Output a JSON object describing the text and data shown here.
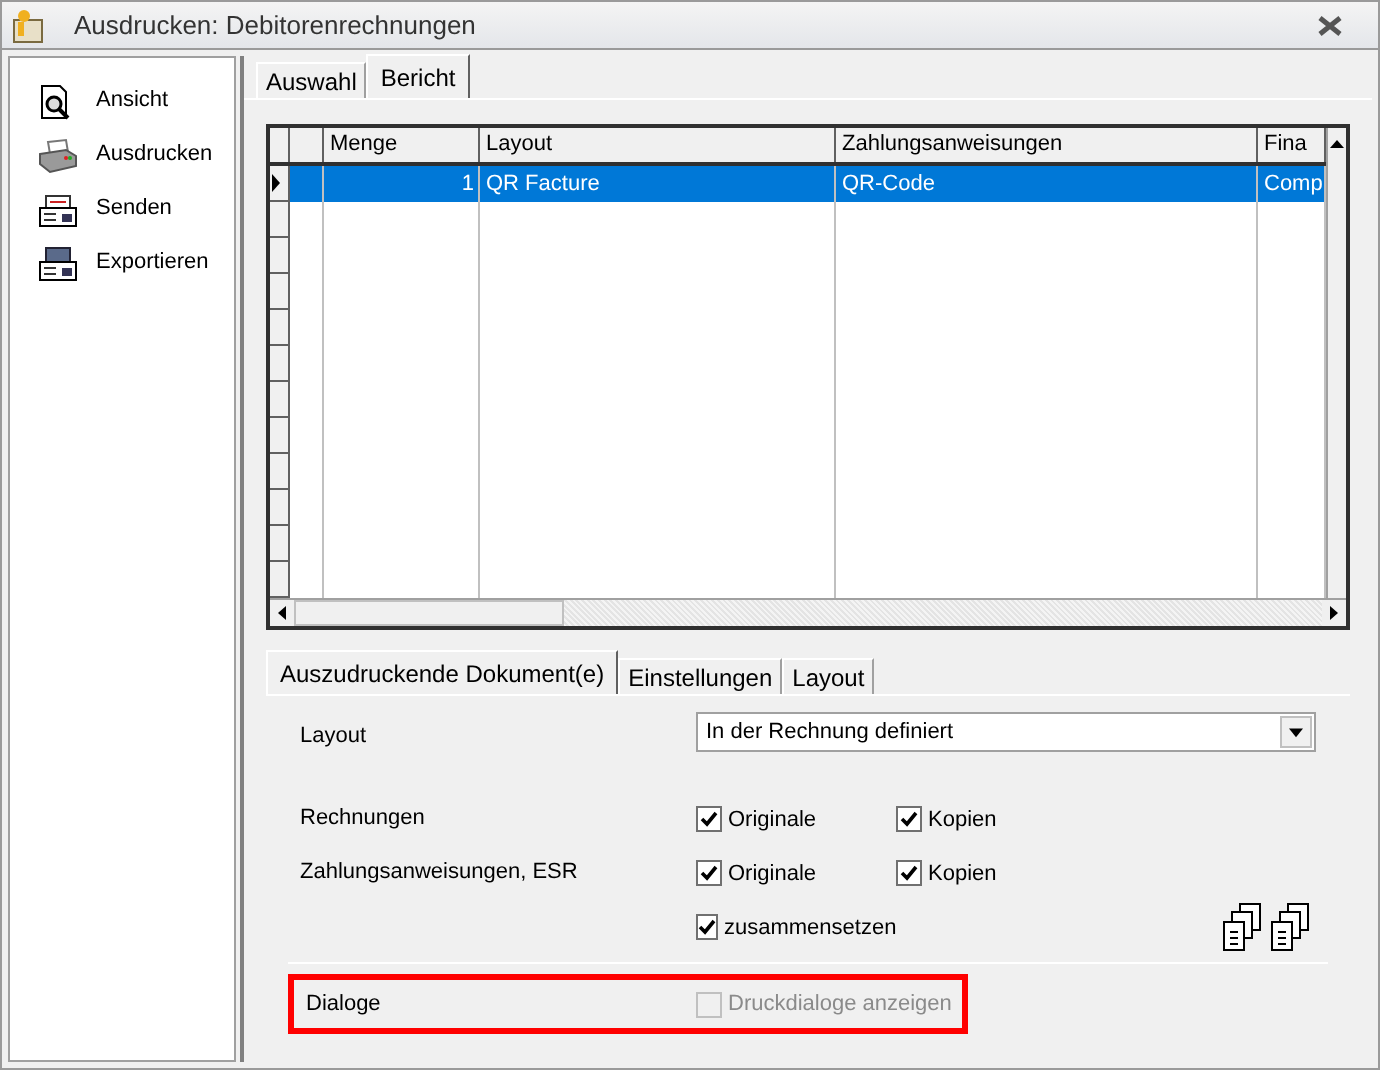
{
  "window": {
    "title": "Ausdrucken: Debitorenrechnungen"
  },
  "sidebar": {
    "items": [
      {
        "label": "Ansicht"
      },
      {
        "label": "Ausdrucken"
      },
      {
        "label": "Senden"
      },
      {
        "label": "Exportieren"
      }
    ]
  },
  "tabs": [
    {
      "label": "Auswahl",
      "selected": false
    },
    {
      "label": "Bericht",
      "selected": true
    }
  ],
  "table": {
    "columns": [
      {
        "label": "Menge"
      },
      {
        "label": "Layout"
      },
      {
        "label": "Zahlungsanweisungen"
      },
      {
        "label": "Fina"
      }
    ],
    "rows": [
      {
        "cells": [
          "1",
          "QR Facture",
          "QR-Code",
          "Comp"
        ],
        "selected": true
      }
    ]
  },
  "subtabs": [
    {
      "label": "Auszudruckende Dokument(e)",
      "selected": true
    },
    {
      "label": "Einstellungen",
      "selected": false
    },
    {
      "label": "Layout",
      "selected": false
    }
  ],
  "form": {
    "layout": {
      "label": "Layout",
      "value": "In der Rechnung definiert"
    },
    "rows": [
      {
        "label": "Rechnungen",
        "options": [
          {
            "label": "Originale",
            "checked": true,
            "disabled": false
          },
          {
            "label": "Kopien",
            "checked": true,
            "disabled": false
          }
        ]
      },
      {
        "label": "Zahlungsanweisungen, ESR",
        "options": [
          {
            "label": "Originale",
            "checked": true,
            "disabled": false
          },
          {
            "label": "Kopien",
            "checked": true,
            "disabled": false
          }
        ]
      },
      {
        "options": [
          {
            "label": "zusammensetzen",
            "checked": true,
            "disabled": false
          }
        ]
      }
    ],
    "dialoge": {
      "label": "Dialoge",
      "highlighted": true,
      "option": {
        "label": "Druckdialoge anzeigen",
        "checked": false,
        "disabled": true
      }
    }
  }
}
